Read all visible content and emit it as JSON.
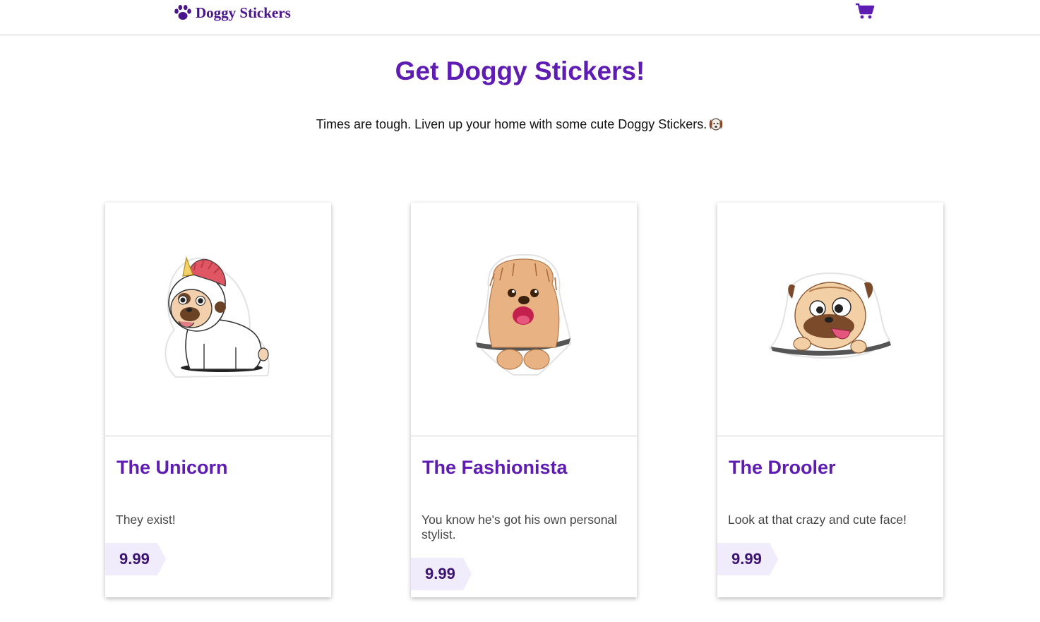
{
  "nav": {
    "brand": "Doggy Stickers",
    "brand_icon": "paw-icon",
    "cart_icon": "cart-icon"
  },
  "hero": {
    "title": "Get Doggy Stickers!",
    "subtitle": "Times are tough. Liven up your home with some cute Doggy Stickers."
  },
  "products": [
    {
      "name": "The Unicorn",
      "description": "They exist!",
      "price": "9.99",
      "image": "unicorn-pug-sticker"
    },
    {
      "name": "The Fashionista",
      "description": "You know he's got his own personal stylist.",
      "price": "9.99",
      "image": "fluffy-dog-sticker"
    },
    {
      "name": "The Drooler",
      "description": "Look at that crazy and cute face!",
      "price": "9.99",
      "image": "drooling-pug-sticker"
    }
  ],
  "colors": {
    "brand": "#4a148c",
    "accent": "#5e1cb3",
    "price_tag": "#f1ecfb"
  }
}
